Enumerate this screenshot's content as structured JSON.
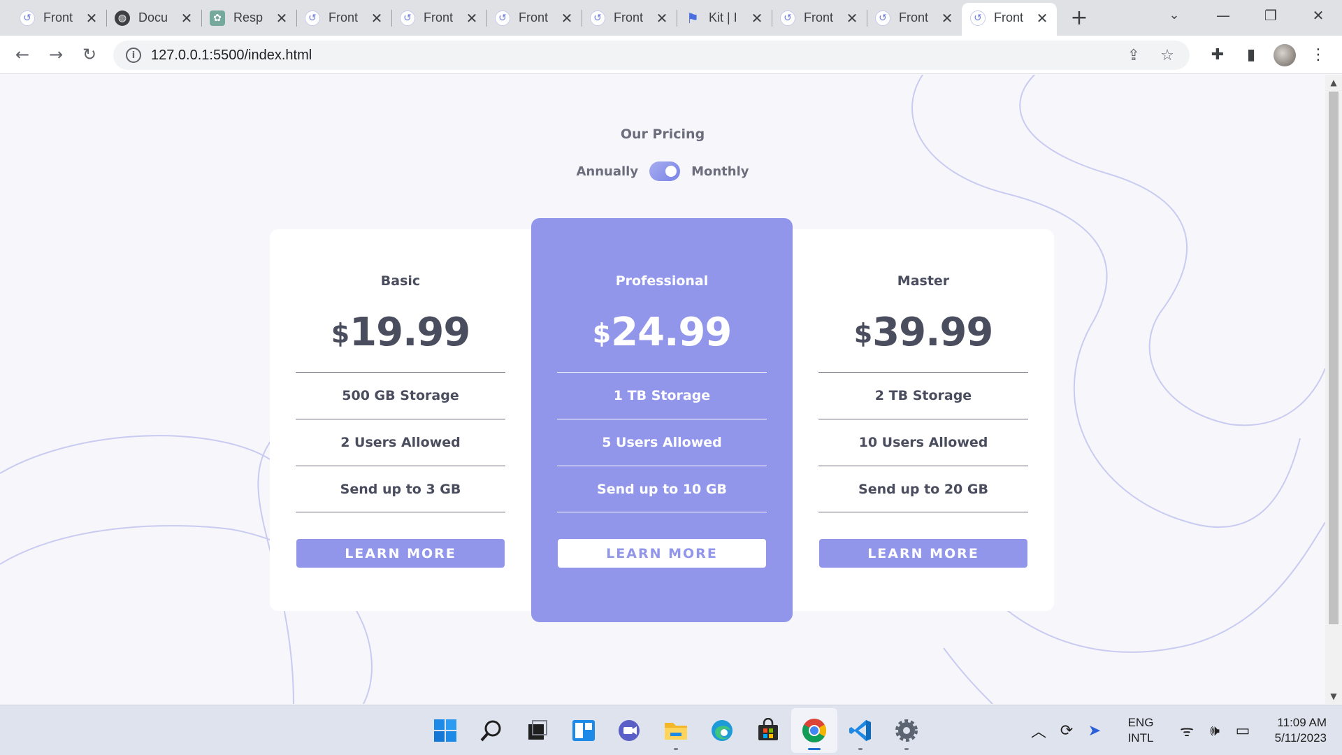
{
  "browser": {
    "tabs": [
      {
        "title": "Front",
        "favicon": "frontend-mentor-icon",
        "active": false
      },
      {
        "title": "Docu",
        "favicon": "globe-icon",
        "active": false
      },
      {
        "title": "Resp",
        "favicon": "chatgpt-icon",
        "active": false
      },
      {
        "title": "Front",
        "favicon": "frontend-mentor-icon",
        "active": false
      },
      {
        "title": "Front",
        "favicon": "frontend-mentor-icon",
        "active": false
      },
      {
        "title": "Front",
        "favicon": "frontend-mentor-icon",
        "active": false
      },
      {
        "title": "Front",
        "favicon": "frontend-mentor-icon",
        "active": false
      },
      {
        "title": "Kit | I",
        "favicon": "flag-icon",
        "active": false
      },
      {
        "title": "Front",
        "favicon": "frontend-mentor-icon",
        "active": false
      },
      {
        "title": "Front",
        "favicon": "frontend-mentor-icon",
        "active": false
      },
      {
        "title": "Front",
        "favicon": "frontend-mentor-icon",
        "active": true
      }
    ],
    "url": "127.0.0.1:5500/index.html"
  },
  "pricing": {
    "title": "Our Pricing",
    "toggle_left": "Annually",
    "toggle_right": "Monthly",
    "toggle_state": "monthly",
    "plans": [
      {
        "name": "Basic",
        "currency": "$",
        "price": "19.99",
        "features": [
          "500 GB Storage",
          "2 Users Allowed",
          "Send up to 3 GB"
        ],
        "button": "LEARN MORE"
      },
      {
        "name": "Professional",
        "currency": "$",
        "price": "24.99",
        "features": [
          "1 TB Storage",
          "5 Users Allowed",
          "Send up to 10 GB"
        ],
        "button": "LEARN MORE"
      },
      {
        "name": "Master",
        "currency": "$",
        "price": "39.99",
        "features": [
          "2 TB Storage",
          "10 Users Allowed",
          "Send up to 20 GB"
        ],
        "button": "LEARN MORE"
      }
    ]
  },
  "taskbar": {
    "apps": [
      "windows-start-icon",
      "search-icon",
      "task-view-icon",
      "widgets-icon",
      "teams-chat-icon",
      "file-explorer-icon",
      "edge-icon",
      "store-icon",
      "chrome-icon",
      "vscode-icon",
      "settings-icon"
    ],
    "lang_line1": "ENG",
    "lang_line2": "INTL",
    "time": "11:09 AM",
    "date": "5/11/2023"
  },
  "colors": {
    "accent": "#9196eb",
    "text_muted": "#6b6d7c",
    "text_dark": "#4a4d5e",
    "page_bg": "#f6f6fb"
  }
}
